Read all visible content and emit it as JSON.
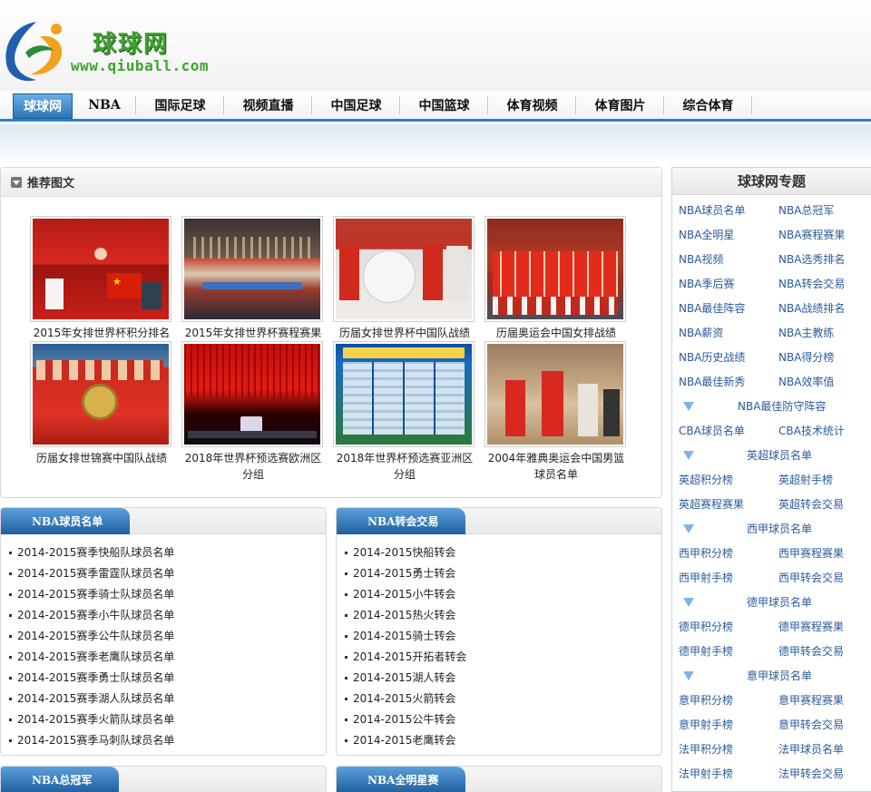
{
  "site": {
    "name": "球球网",
    "url": "www.qiuball.com"
  },
  "colors": {
    "nav_accent": "#2f7fc0",
    "logo_green": "#3fa32f",
    "link_blue": "#2a5b9c"
  },
  "nav": {
    "items": [
      {
        "label": "球球网",
        "active": true
      },
      {
        "label": "NBA"
      },
      {
        "label": "国际足球"
      },
      {
        "label": "视频直播"
      },
      {
        "label": "中国足球"
      },
      {
        "label": "中国篮球"
      },
      {
        "label": "体育视频"
      },
      {
        "label": "体育图片"
      },
      {
        "label": "综合体育"
      }
    ]
  },
  "recommended": {
    "title": "推荐图文",
    "items": [
      {
        "caption": "2015年女排世界杯积分排名",
        "theme": "team-flag"
      },
      {
        "caption": "2015年女排世界杯赛程赛果",
        "theme": "arena"
      },
      {
        "caption": "历届女排世界杯中国队战绩",
        "theme": "ball-celebration"
      },
      {
        "caption": "历届奥运会中国女排战绩",
        "theme": "podium-line"
      },
      {
        "caption": "历届女排世锦赛中国队战绩",
        "theme": "team-trophy"
      },
      {
        "caption": "2018年世界杯预选赛欧洲区分组",
        "theme": "draw-stage"
      },
      {
        "caption": "2018年世界杯预选赛亚洲区分组",
        "theme": "draw-board"
      },
      {
        "caption": "2004年雅典奥运会中国男篮球员名单",
        "theme": "basketball-team"
      }
    ]
  },
  "boxes": [
    {
      "title": "NBA球员名单",
      "items": [
        "2014-2015赛季快船队球员名单",
        "2014-2015赛季雷霆队球员名单",
        "2014-2015赛季骑士队球员名单",
        "2014-2015赛季小牛队球员名单",
        "2014-2015赛季公牛队球员名单",
        "2014-2015赛季老鹰队球员名单",
        "2014-2015赛季勇士队球员名单",
        "2014-2015赛季湖人队球员名单",
        "2014-2015赛季火箭队球员名单",
        "2014-2015赛季马刺队球员名单"
      ]
    },
    {
      "title": "NBA转会交易",
      "items": [
        "2014-2015快船转会",
        "2014-2015勇士转会",
        "2014-2015小牛转会",
        "2014-2015热火转会",
        "2014-2015骑士转会",
        "2014-2015开拓者转会",
        "2014-2015湖人转会",
        "2014-2015火箭转会",
        "2014-2015公牛转会",
        "2014-2015老鹰转会"
      ]
    },
    {
      "title": "NBA总冠军",
      "items": []
    },
    {
      "title": "NBA全明星赛",
      "items": []
    }
  ],
  "sidebar": {
    "title": "球球网专题",
    "rows": [
      {
        "type": "pair",
        "left": "NBA球员名单",
        "right": "NBA总冠军"
      },
      {
        "type": "pair",
        "left": "NBA全明星",
        "right": "NBA赛程赛果"
      },
      {
        "type": "pair",
        "left": "NBA视频",
        "right": "NBA选秀排名"
      },
      {
        "type": "pair",
        "left": "NBA季后赛",
        "right": "NBA转会交易"
      },
      {
        "type": "pair",
        "left": "NBA最佳阵容",
        "right": "NBA战绩排名"
      },
      {
        "type": "pair",
        "left": "NBA薪资",
        "right": "NBA主教练"
      },
      {
        "type": "pair",
        "left": "NBA历史战绩",
        "right": "NBA得分榜"
      },
      {
        "type": "pair",
        "left": "NBA最佳新秀",
        "right": "NBA效率值"
      },
      {
        "type": "head",
        "label": "NBA最佳防守阵容"
      },
      {
        "type": "pair",
        "left": "CBA球员名单",
        "right": "CBA技术统计"
      },
      {
        "type": "head",
        "label": "英超球员名单"
      },
      {
        "type": "pair",
        "left": "英超积分榜",
        "right": "英超射手榜"
      },
      {
        "type": "pair",
        "left": "英超赛程赛果",
        "right": "英超转会交易"
      },
      {
        "type": "head",
        "label": "西甲球员名单"
      },
      {
        "type": "pair",
        "left": "西甲积分榜",
        "right": "西甲赛程赛果"
      },
      {
        "type": "pair",
        "left": "西甲射手榜",
        "right": "西甲转会交易"
      },
      {
        "type": "head",
        "label": "德甲球员名单"
      },
      {
        "type": "pair",
        "left": "德甲积分榜",
        "right": "德甲赛程赛果"
      },
      {
        "type": "pair",
        "left": "德甲射手榜",
        "right": "德甲转会交易"
      },
      {
        "type": "head",
        "label": "意甲球员名单"
      },
      {
        "type": "pair",
        "left": "意甲积分榜",
        "right": "意甲赛程赛果"
      },
      {
        "type": "pair",
        "left": "意甲射手榜",
        "right": "意甲转会交易"
      },
      {
        "type": "pair",
        "left": "法甲积分榜",
        "right": "法甲球员名单"
      },
      {
        "type": "pair",
        "left": "法甲射手榜",
        "right": "法甲转会交易"
      }
    ]
  }
}
